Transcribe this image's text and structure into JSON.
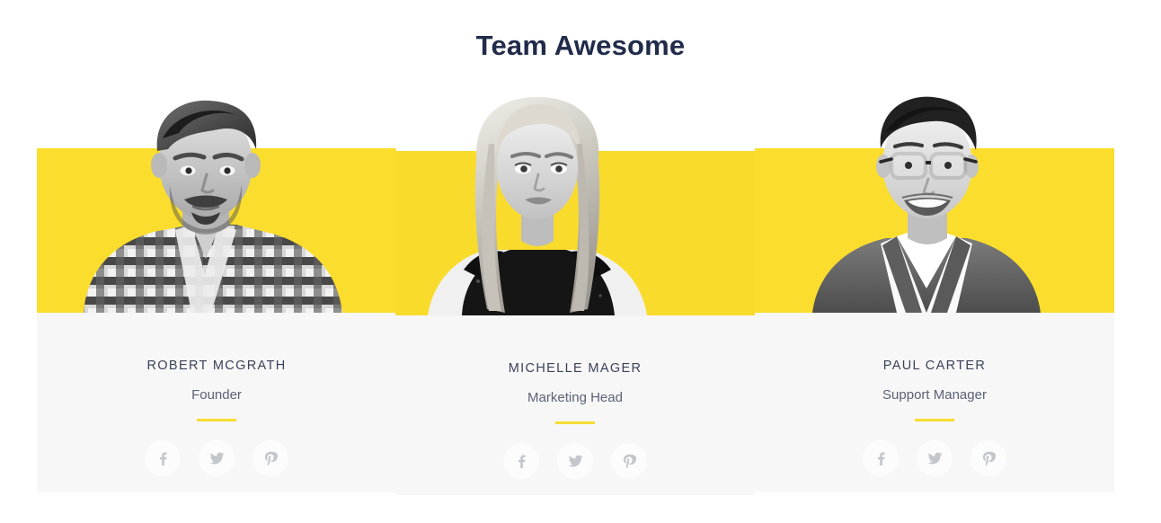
{
  "page": {
    "title": "Team Awesome",
    "background_color": "#ffffff"
  },
  "theme": {
    "accent_yellow": "#fbdd2d",
    "divider_yellow": "#f7dc31",
    "panel_gray": "#f7f7f7",
    "social_circle": "#fcfcfc",
    "social_icon": "#c3c6cb",
    "heading_navy": "#212b4a",
    "name_color": "#3b4259",
    "role_color": "#5a6275"
  },
  "members": [
    {
      "name": "ROBERT MCGRATH",
      "role": "Founder",
      "photo_alt": "grayscale portrait of young man with pompadour hair and plaid shirt",
      "socials": [
        {
          "network": "facebook",
          "icon": "facebook-icon"
        },
        {
          "network": "twitter",
          "icon": "twitter-icon"
        },
        {
          "network": "pinterest",
          "icon": "pinterest-icon"
        }
      ]
    },
    {
      "name": "MICHELLE MAGER",
      "role": "Marketing Head",
      "photo_alt": "grayscale portrait of young woman with long blonde hair in black ruffled top",
      "socials": [
        {
          "network": "facebook",
          "icon": "facebook-icon"
        },
        {
          "network": "twitter",
          "icon": "twitter-icon"
        },
        {
          "network": "pinterest",
          "icon": "pinterest-icon"
        }
      ]
    },
    {
      "name": "PAUL CARTER",
      "role": "Support Manager",
      "photo_alt": "grayscale portrait of smiling man with glasses in a suit jacket",
      "socials": [
        {
          "network": "facebook",
          "icon": "facebook-icon"
        },
        {
          "network": "twitter",
          "icon": "twitter-icon"
        },
        {
          "network": "pinterest",
          "icon": "pinterest-icon"
        }
      ]
    }
  ]
}
